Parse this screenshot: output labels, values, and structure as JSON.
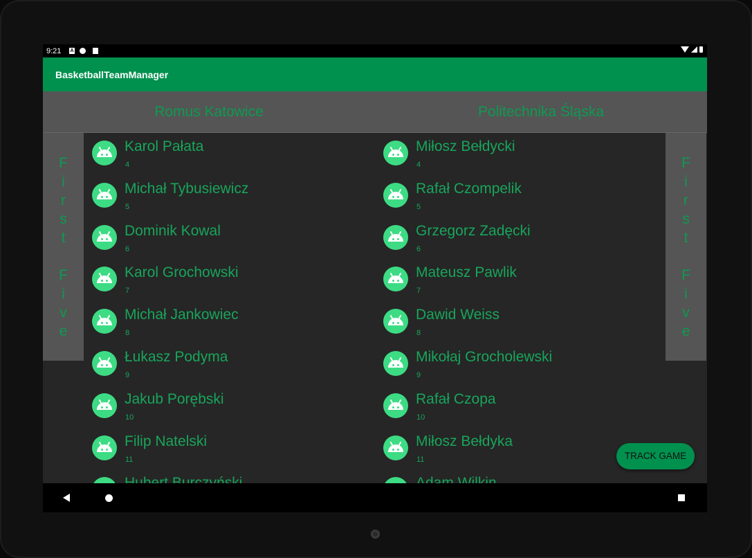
{
  "status": {
    "time": "9:21"
  },
  "app": {
    "title": "BasketballTeamManager"
  },
  "teams": {
    "left": "Romus Katowice",
    "right": "Politechnika Śląska"
  },
  "side_label": "F\ni\nr\ns\nt\n\nF\ni\nv\ne",
  "left_players": [
    {
      "name": "Karol Pałata",
      "number": "4"
    },
    {
      "name": "Michał Tybusiewicz",
      "number": "5"
    },
    {
      "name": "Dominik Kowal",
      "number": "6"
    },
    {
      "name": "Karol Grochowski",
      "number": "7"
    },
    {
      "name": "Michał Jankowiec",
      "number": "8"
    },
    {
      "name": "Łukasz Podyma",
      "number": "9"
    },
    {
      "name": "Jakub Porębski",
      "number": "10"
    },
    {
      "name": "Filip Natelski",
      "number": "11"
    },
    {
      "name": "Hubert Burczyński",
      "number": ""
    }
  ],
  "right_players": [
    {
      "name": "Miłosz Bełdycki",
      "number": "4"
    },
    {
      "name": "Rafał Czompelik",
      "number": "5"
    },
    {
      "name": "Grzegorz Zadęcki",
      "number": "6"
    },
    {
      "name": "Mateusz Pawlik",
      "number": "7"
    },
    {
      "name": "Dawid Weiss",
      "number": "8"
    },
    {
      "name": "Mikołaj Grocholewski",
      "number": "9"
    },
    {
      "name": "Rafał Czopa",
      "number": "10"
    },
    {
      "name": "Miłosz Bełdyka",
      "number": "11"
    },
    {
      "name": "Adam Wilkin",
      "number": ""
    }
  ],
  "fab": {
    "label": "TRACK GAME"
  },
  "colors": {
    "accent": "#00914e",
    "text_green": "#18a55b",
    "avatar": "#3ddc84",
    "background": "#262626",
    "header": "#555555"
  },
  "icons": {
    "avatar": "android-robot-icon",
    "nav_back": "back-triangle-icon",
    "nav_home": "home-circle-icon",
    "nav_recent": "recents-square-icon"
  }
}
